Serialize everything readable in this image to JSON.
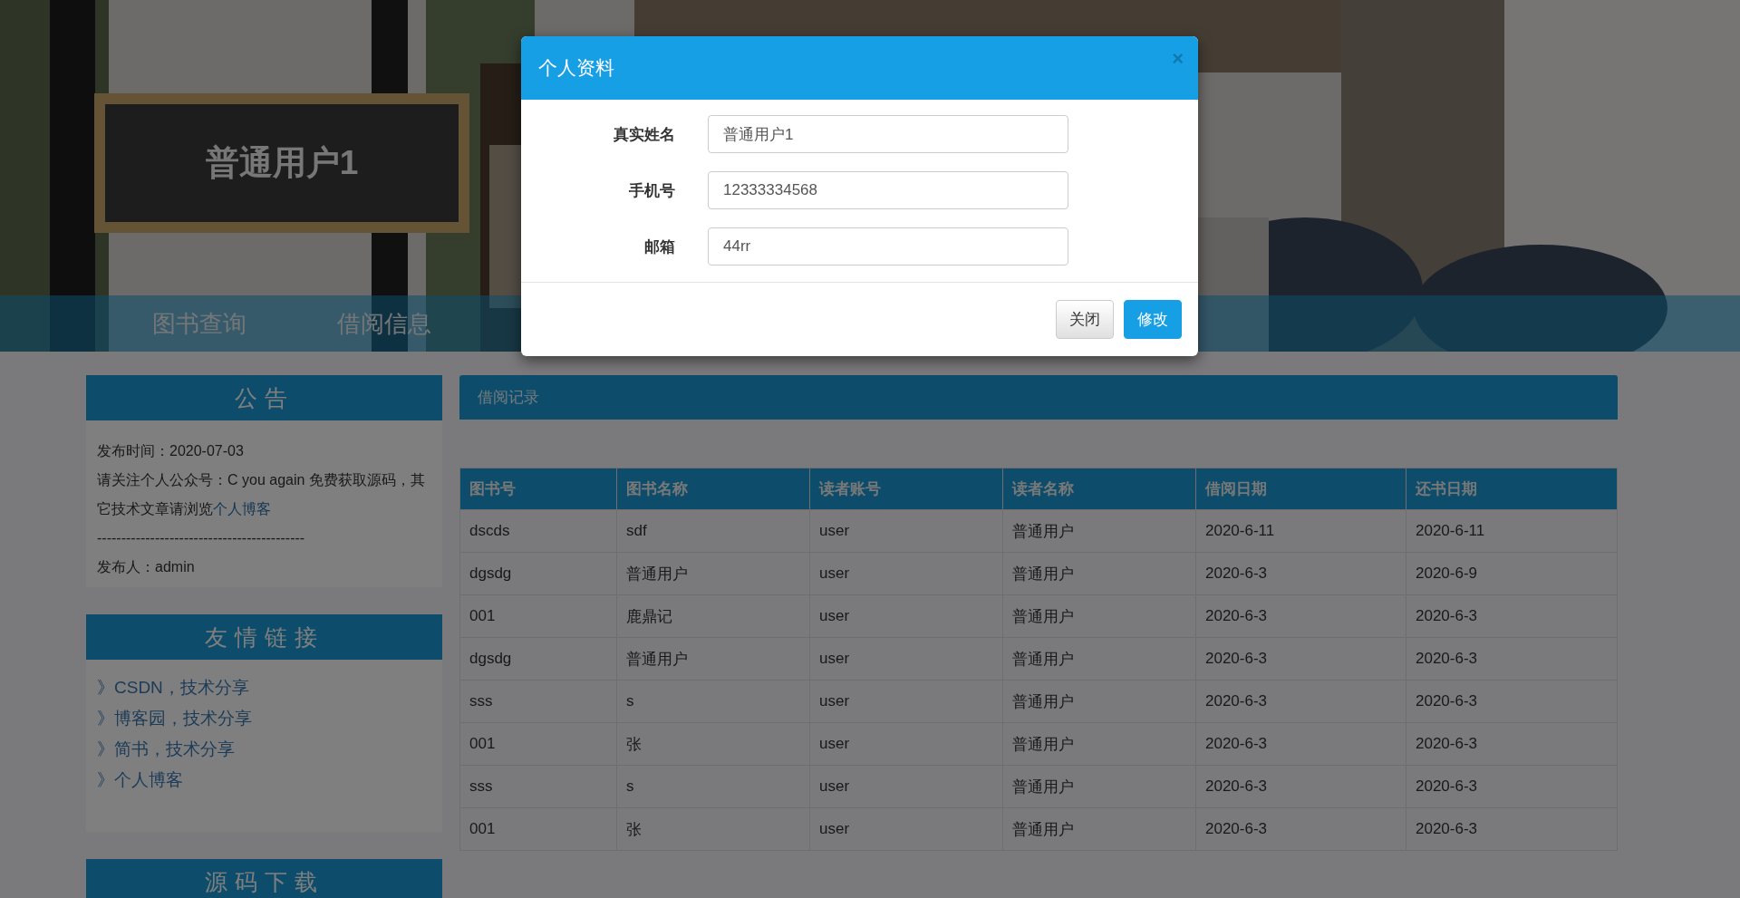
{
  "header": {
    "user_name": "普通用户1"
  },
  "nav": {
    "items": [
      {
        "label": "图书查询"
      },
      {
        "label": "借阅信息"
      }
    ]
  },
  "sidebar": {
    "panels": [
      {
        "kind": "notice",
        "title": "公告",
        "date": "发布时间：2020-07-03",
        "text": "请关注个人公众号：C you again 免费获取源码，其它技术文章请浏览",
        "link": "个人博客",
        "divider": "-------------------------------------------",
        "author": "发布人：admin"
      },
      {
        "kind": "links",
        "title": "友情链接",
        "links": [
          "》CSDN，技术分享",
          "》博客园，技术分享",
          "》简书，技术分享",
          "》个人博客"
        ]
      },
      {
        "kind": "download",
        "title": "源码下载"
      }
    ]
  },
  "records": {
    "title": "借阅记录",
    "columns": [
      "图书号",
      "图书名称",
      "读者账号",
      "读者名称",
      "借阅日期",
      "还书日期"
    ],
    "rows": [
      [
        "dscds",
        "sdf",
        "user",
        "普通用户",
        "2020-6-11",
        "2020-6-11"
      ],
      [
        "dgsdg",
        "普通用户",
        "user",
        "普通用户",
        "2020-6-3",
        "2020-6-9"
      ],
      [
        "001",
        "鹿鼎记",
        "user",
        "普通用户",
        "2020-6-3",
        "2020-6-3"
      ],
      [
        "dgsdg",
        "普通用户",
        "user",
        "普通用户",
        "2020-6-3",
        "2020-6-3"
      ],
      [
        "sss",
        "s",
        "user",
        "普通用户",
        "2020-6-3",
        "2020-6-3"
      ],
      [
        "001",
        "张",
        "user",
        "普通用户",
        "2020-6-3",
        "2020-6-3"
      ],
      [
        "sss",
        "s",
        "user",
        "普通用户",
        "2020-6-3",
        "2020-6-3"
      ],
      [
        "001",
        "张",
        "user",
        "普通用户",
        "2020-6-3",
        "2020-6-3"
      ]
    ]
  },
  "modal": {
    "title": "个人资料",
    "close": "×",
    "fields": [
      {
        "label": "真实姓名",
        "value": "普通用户1"
      },
      {
        "label": "手机号",
        "value": "12333334568"
      },
      {
        "label": "邮箱",
        "value": "44rr"
      }
    ],
    "buttons": [
      {
        "kind": "default",
        "label": "关闭"
      },
      {
        "kind": "primary",
        "label": "修改"
      }
    ]
  }
}
